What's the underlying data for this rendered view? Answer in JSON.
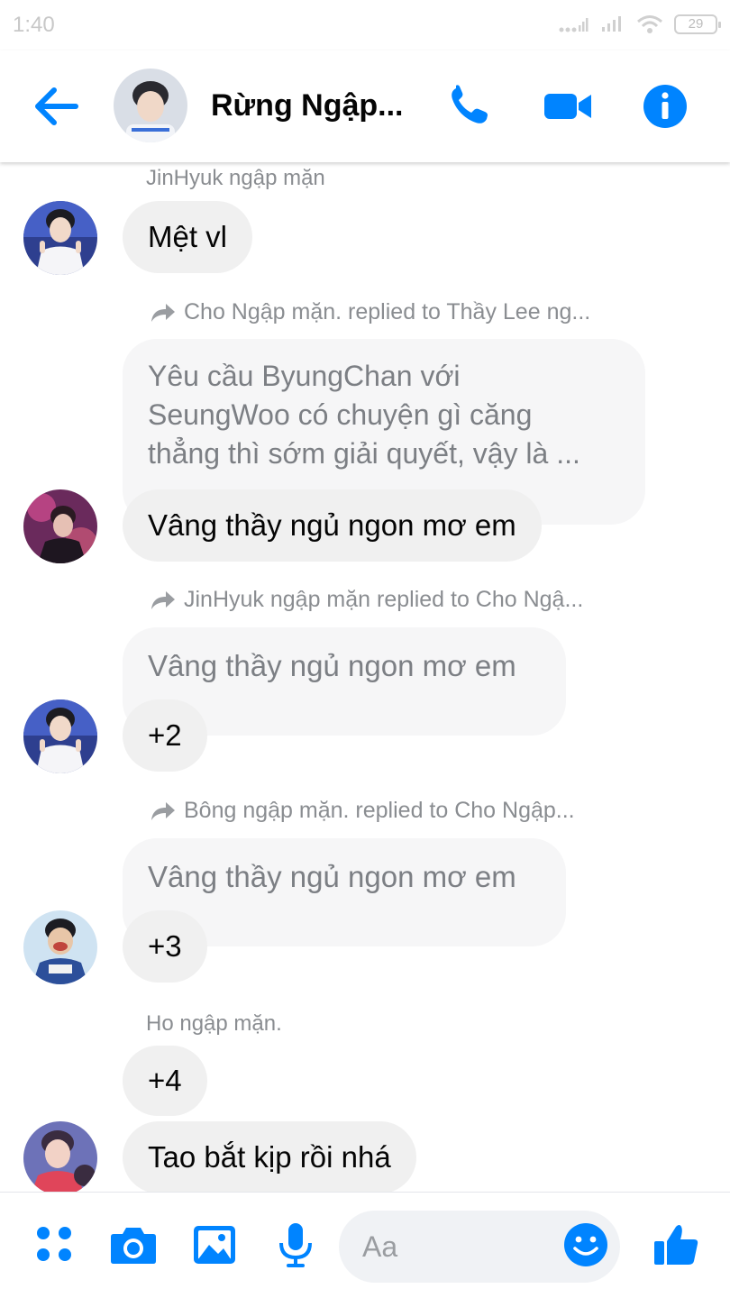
{
  "status": {
    "time": "1:40",
    "battery": "29"
  },
  "header": {
    "title": "Rừng Ngập..."
  },
  "messages": [
    {
      "sender": "JinHyuk ngập mặn",
      "text": "Mệt vl"
    },
    {
      "reply_note": "Cho Ngập mặn. replied to Thầy Lee ng...",
      "quoted": [
        "Yêu cầu ByungChan với",
        "SeungWoo có chuyện gì căng",
        "thẳng thì sớm giải quyết, vậy là ..."
      ],
      "text": "Vâng thầy ngủ ngon mơ em"
    },
    {
      "reply_note": "JinHyuk ngập mặn replied to Cho Ngậ...",
      "quoted": "Vâng thầy ngủ ngon mơ em",
      "text": "+2"
    },
    {
      "reply_note": "Bông ngập mặn. replied to Cho Ngập...",
      "quoted": "Vâng thầy ngủ ngon mơ em",
      "text": "+3"
    },
    {
      "sender": "Ho ngập mặn.",
      "texts": [
        "+4",
        "Tao bắt kịp rồi nhá"
      ]
    }
  ],
  "composer": {
    "placeholder": "Aa"
  },
  "colors": {
    "accent": "#0084ff",
    "bubble": "#f0f0f0",
    "meta_text": "#8a8d91"
  }
}
